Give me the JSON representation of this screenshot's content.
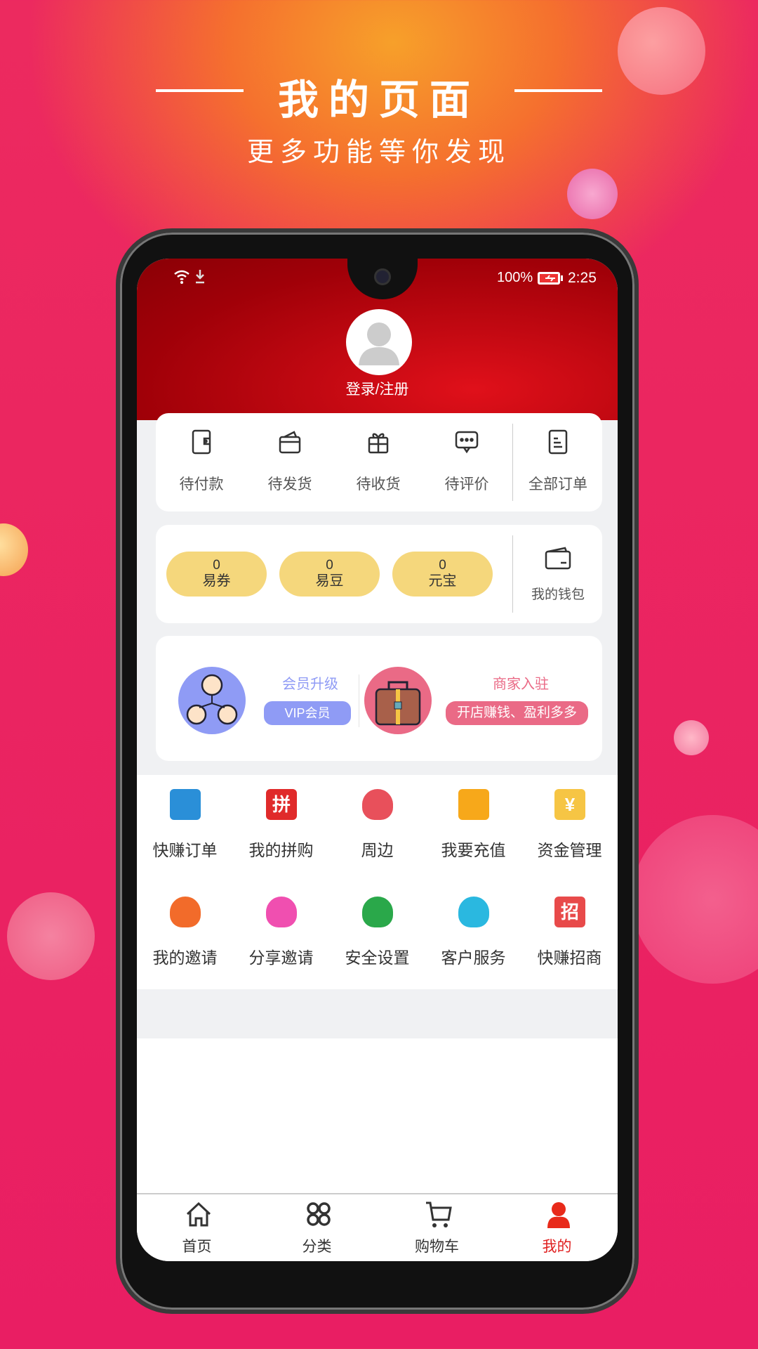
{
  "promo": {
    "title": "我的页面",
    "subtitle": "更多功能等你发现"
  },
  "status_bar": {
    "battery": "100%",
    "time": "2:25"
  },
  "profile": {
    "login_label": "登录/注册"
  },
  "orders": {
    "items": [
      {
        "label": "待付款",
        "icon": "wallet-icon"
      },
      {
        "label": "待发货",
        "icon": "package-icon"
      },
      {
        "label": "待收货",
        "icon": "gift-icon"
      },
      {
        "label": "待评价",
        "icon": "chat-icon"
      },
      {
        "label": "全部订单",
        "icon": "document-icon"
      }
    ]
  },
  "wallet": {
    "items": [
      {
        "value": "0",
        "label": "易券"
      },
      {
        "value": "0",
        "label": "易豆"
      },
      {
        "value": "0",
        "label": "元宝"
      }
    ],
    "my_wallet": "我的钱包"
  },
  "promo_cards": {
    "vip": {
      "title": "会员升级",
      "button": "VIP会员",
      "color": "#8f9bf5"
    },
    "merchant": {
      "title": "商家入驻",
      "button": "开店赚钱、盈利多多",
      "color": "#ea6a86"
    }
  },
  "grid": {
    "items": [
      {
        "label": "快赚订单",
        "icon": "order-doc-icon",
        "color": "#2a8fd8"
      },
      {
        "label": "我的拼购",
        "icon": "group-buy-icon",
        "glyph": "拼",
        "color": "#e02a2a"
      },
      {
        "label": "周边",
        "icon": "location-pin-icon",
        "color": "#e8505b"
      },
      {
        "label": "我要充值",
        "icon": "card-icon",
        "color": "#f7a81a"
      },
      {
        "label": "资金管理",
        "icon": "money-ticket-icon",
        "glyph": "¥",
        "color": "#f6c544"
      },
      {
        "label": "我的邀请",
        "icon": "add-user-icon",
        "color": "#f26b2a"
      },
      {
        "label": "分享邀请",
        "icon": "users-icon",
        "color": "#f04fb0"
      },
      {
        "label": "安全设置",
        "icon": "shield-check-icon",
        "color": "#2aa84a"
      },
      {
        "label": "客户服务",
        "icon": "customer-service-icon",
        "color": "#2ab8e0"
      },
      {
        "label": "快赚招商",
        "icon": "shop-icon",
        "glyph": "招",
        "color": "#e84a4a"
      }
    ]
  },
  "nav": {
    "items": [
      {
        "label": "首页",
        "icon": "home-icon"
      },
      {
        "label": "分类",
        "icon": "category-icon"
      },
      {
        "label": "购物车",
        "icon": "cart-icon"
      },
      {
        "label": "我的",
        "icon": "user-icon",
        "active": true
      }
    ],
    "active_color": "#e02020"
  }
}
